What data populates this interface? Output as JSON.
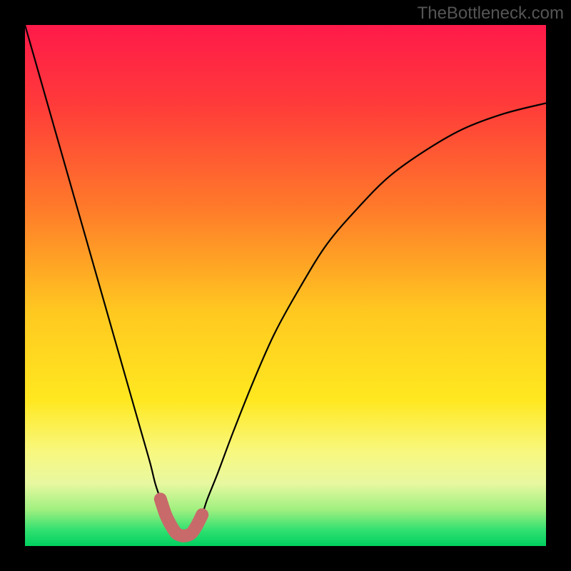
{
  "watermark": "TheBottleneck.com",
  "chart_data": {
    "type": "line",
    "title": "",
    "xlabel": "",
    "ylabel": "",
    "xlim": [
      0,
      100
    ],
    "ylim": [
      0,
      100
    ],
    "background_gradient": {
      "stops": [
        {
          "pct": 0,
          "color": "#ff1a4a"
        },
        {
          "pct": 15,
          "color": "#ff3a3a"
        },
        {
          "pct": 35,
          "color": "#ff7a2a"
        },
        {
          "pct": 55,
          "color": "#ffc820"
        },
        {
          "pct": 72,
          "color": "#ffe820"
        },
        {
          "pct": 82,
          "color": "#f8f880"
        },
        {
          "pct": 88,
          "color": "#e8f8a0"
        },
        {
          "pct": 93,
          "color": "#a0f080"
        },
        {
          "pct": 97,
          "color": "#30e070"
        },
        {
          "pct": 100,
          "color": "#00d060"
        }
      ]
    },
    "series": [
      {
        "name": "bottleneck-curve",
        "x": [
          0,
          2,
          4,
          6,
          8,
          10,
          12,
          14,
          16,
          18,
          20,
          22,
          24,
          25,
          26,
          27,
          28,
          29,
          30,
          31,
          32,
          33,
          34,
          35,
          37,
          40,
          44,
          48,
          53,
          58,
          64,
          70,
          77,
          84,
          92,
          100
        ],
        "y": [
          100,
          93,
          86,
          79,
          72,
          65,
          58,
          51,
          44,
          37,
          30,
          23,
          16,
          12,
          9,
          6,
          4,
          2.5,
          2,
          2,
          2.5,
          4,
          6,
          9,
          14,
          22,
          32,
          41,
          50,
          58,
          65,
          71,
          76,
          80,
          83,
          85
        ]
      }
    ],
    "highlight": {
      "name": "optimal-range",
      "color": "#c86a6a",
      "x": [
        26,
        27,
        28,
        29,
        30,
        31,
        32,
        33,
        34
      ],
      "y": [
        9,
        6,
        4,
        2.5,
        2,
        2,
        2.5,
        4,
        6
      ]
    }
  }
}
